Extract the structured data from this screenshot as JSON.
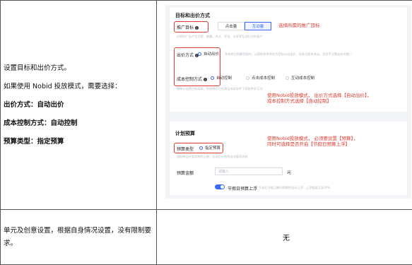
{
  "row1": {
    "left_intro": "设置目标和出价方式。",
    "left_mode": "如果使用 Nobid 投放模式，需要选择：",
    "left_bid": "出价方式：自动出价",
    "left_cost": "成本控制方式：自动控制",
    "left_budget": "预算类型：指定预算"
  },
  "screenshot": {
    "section1_title": "目标和出价方式",
    "promo_goal_label": "推广目标",
    "promo_goal_options": [
      "点击量",
      "互动量"
    ],
    "promo_goal_hint": "对您的广告产生点赞、收藏、关注、评论、分享等互动行为的客户",
    "bid_method_label": "出价方式",
    "bid_method_option": "自动出价",
    "bid_method_hint": "系统将在预算范围内，以获取更多转化为目标自动出价，成本可能有波动，适合不设置出价的推广",
    "cost_control_label": "成本控制方式",
    "cost_control_options": [
      "自动控制",
      "点击成本控制",
      "互动成本控制"
    ],
    "cost_control_hint": "按单元设置目标成本，系统将尽力在满足成本条件下获取更多互动",
    "section2_title": "计划预算",
    "budget_type_label": "预算类型",
    "budget_type_option": "指定预算",
    "budget_type_hint": "限制每日计划消耗的上限，达成后计划将自动暂停消耗",
    "budget_amount_label": "预算金额",
    "budget_amount_placeholder": "请输入",
    "budget_unit": "元",
    "holiday_toggle_label": "节假日预算上浮",
    "holiday_toggle_hint": "开启后节假日期间预算将自动上浮，上浮幅度至多20%"
  },
  "annotations": {
    "goal_note": "选择所需的推广目标",
    "bid_note_line1": "使用Nobid投放模式，  出价方式选择【自动出价】，",
    "bid_note_line2": "成本控制方式选择【自动控制】",
    "budget_note_line1": "使用Nobid投放模式，  必须要设置【预算】，",
    "budget_note_line2": "同时可选择是否开启【节假日预算上浮】"
  },
  "row2": {
    "left": "单元及创意设置，根据自身情况设置，没有限制要求。",
    "right": "无"
  },
  "colors": {
    "accent": "#3a6cf5",
    "annotation": "#e03a2e",
    "border": "#555555"
  }
}
